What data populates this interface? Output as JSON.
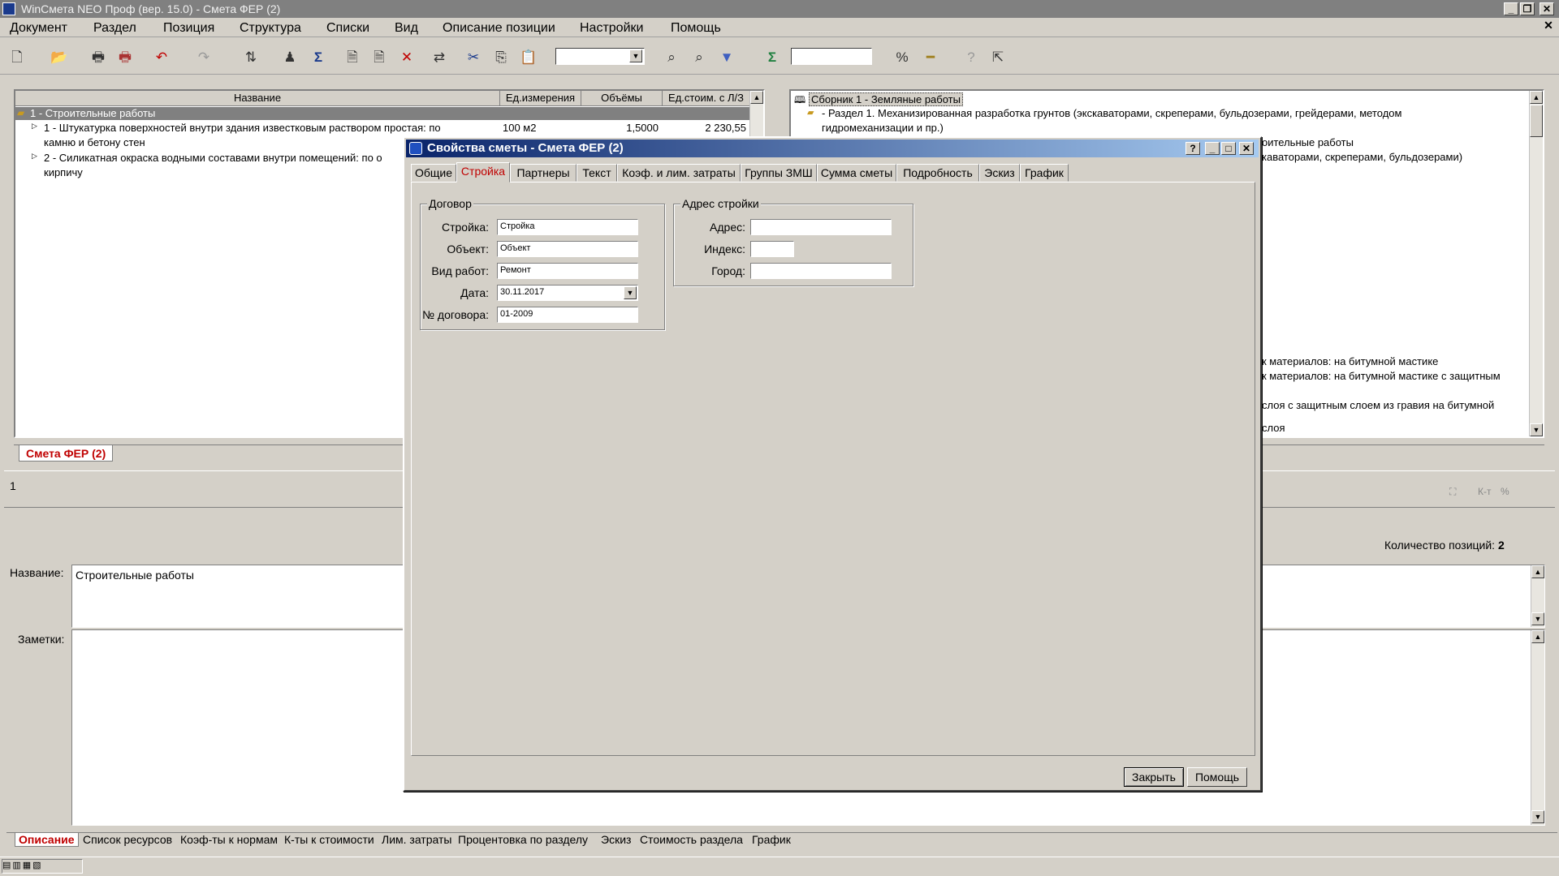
{
  "app": {
    "title": "WinСмета NEO Проф (вер. 15.0) - Смета ФЕР (2)"
  },
  "menu": [
    "Документ",
    "Раздел",
    "Позиция",
    "Структура",
    "Списки",
    "Вид",
    "Описание позиции",
    "Настройки",
    "Помощь"
  ],
  "left_table": {
    "headers": [
      "Название",
      "Ед.измерения",
      "Объёмы",
      "Ед.стоим. с Л/З"
    ],
    "rows": [
      {
        "name": "1 - Строительные работы",
        "unit": "",
        "volume": "",
        "cost": ""
      },
      {
        "name1": "1 - Штукатурка поверхностей внутри здания известковым раствором простая: по",
        "name2": "камню и бетону стен",
        "unit": "100 м2",
        "volume": "1,5000",
        "cost": "2 230,55"
      },
      {
        "name1": "2 - Силикатная окраска водными составами внутри помещений: по о",
        "name2": "кирпичу"
      }
    ]
  },
  "right_tree": {
    "items": [
      "Сборник 1 - Земляные работы",
      "- Раздел 1. Механизированная разработка грунтов (экскаваторами, скреперами, бульдозерами, грейдерами, методом",
      "гидромеханизации и пр.)",
      "оительные работы",
      "каваторами, скреперами, бульдозерами)",
      "к материалов: на битумной мастике",
      "к материалов: на битумной мастике с защитным",
      "слоя с защитным слоем из гравия на битумной",
      "слоя"
    ]
  },
  "doc_tab": "Смета ФЕР (2)",
  "middle": {
    "row_number": "1",
    "positions_label": "Количество позиций:",
    "positions_count": "2",
    "kt_label": "К-т",
    "percent_label": "%"
  },
  "fields": {
    "name_label": "Название:",
    "name_value": "Строительные работы",
    "notes_label": "Заметки:"
  },
  "bottom_tabs": [
    "Описание",
    "Список ресурсов",
    "Коэф-ты к нормам",
    "К-ты к стоимости",
    "Лим. затраты",
    "Процентовка по разделу",
    "Эскиз",
    "Стоимость раздела",
    "График"
  ],
  "dialog": {
    "title": "Свойства сметы - Смета ФЕР (2)",
    "tabs": [
      "Общие",
      "Стройка",
      "Партнеры",
      "Текст",
      "Коэф. и лим. затраты",
      "Группы ЗМШ",
      "Сумма сметы",
      "Подробность",
      "Эскиз",
      "График"
    ],
    "contract": {
      "caption": "Договор",
      "stroika_label": "Стройка:",
      "stroika_value": "Стройка",
      "object_label": "Объект:",
      "object_value": "Объект",
      "work_label": "Вид работ:",
      "work_value": "Ремонт",
      "date_label": "Дата:",
      "date_value": "30.11.2017",
      "number_label": "№ договора:",
      "number_value": "01-2009"
    },
    "address": {
      "caption": "Адрес стройки",
      "address_label": "Адрес:",
      "address_value": "",
      "index_label": "Индекс:",
      "index_value": "",
      "city_label": "Город:",
      "city_value": ""
    },
    "close_button": "Закрыть",
    "help_button": "Помощь"
  }
}
